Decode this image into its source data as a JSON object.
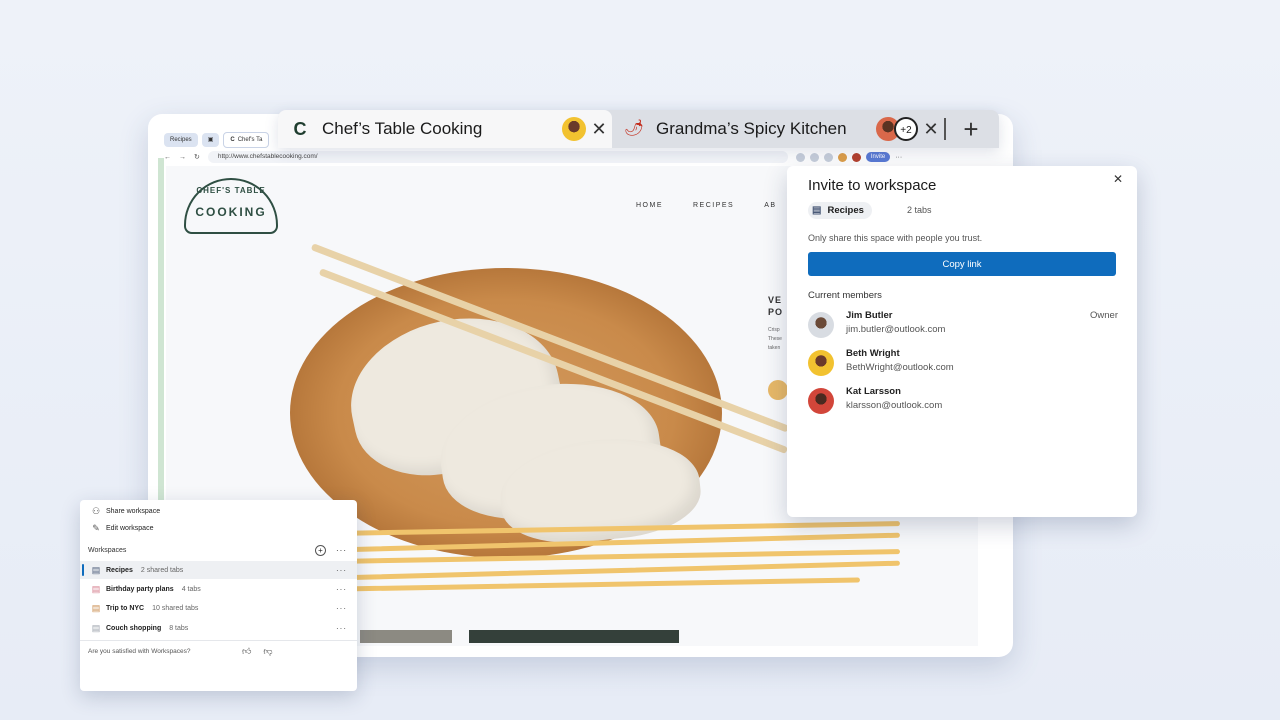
{
  "tabs": [
    {
      "title": "Chef’s Table Cooking",
      "favicon": "C",
      "close": "✕"
    },
    {
      "title": "Grandma’s Spicy Kitchen",
      "favicon": "chili-icon",
      "extra_members": "+2",
      "close": "✕"
    }
  ],
  "new_tab": "+",
  "browser": {
    "mini_tabs": [
      "Recipes",
      "Chef's Ta"
    ],
    "url": "http://www.chefstablecooking.com/",
    "invite_chip": "Invite"
  },
  "site": {
    "logo_top": "CHEF'S TABLE",
    "logo_bottom": "COOKING",
    "nav": [
      "HOME",
      "RECIPES",
      "AB"
    ],
    "hero_heading": "VE PO",
    "hero_body": "Crisp These taken"
  },
  "invite": {
    "title": "Invite to workspace",
    "close": "✕",
    "workspace": "Recipes",
    "tab_count": "2 tabs",
    "note": "Only share this space with people you trust.",
    "copy_button": "Copy link",
    "members_heading": "Current members",
    "members": [
      {
        "name": "Jim Butler",
        "email": "jim.butler@outlook.com",
        "role": "Owner"
      },
      {
        "name": "Beth Wright",
        "email": "BethWright@outlook.com",
        "role": ""
      },
      {
        "name": "Kat Larsson",
        "email": "klarsson@outlook.com",
        "role": ""
      }
    ]
  },
  "workspaces_panel": {
    "share": "Share workspace",
    "edit": "Edit workspace",
    "heading": "Workspaces",
    "more": "···",
    "items": [
      {
        "name": "Recipes",
        "count": "2 shared tabs"
      },
      {
        "name": "Birthday party plans",
        "count": "4 tabs"
      },
      {
        "name": "Trip to NYC",
        "count": "10 shared tabs"
      },
      {
        "name": "Couch shopping",
        "count": "8 tabs"
      }
    ],
    "feedback": "Are you satisfied with Workspaces?"
  },
  "colors": {
    "accent": "#0f6cbd",
    "background": "#eef2f9",
    "stripe": "#f0c46c"
  }
}
